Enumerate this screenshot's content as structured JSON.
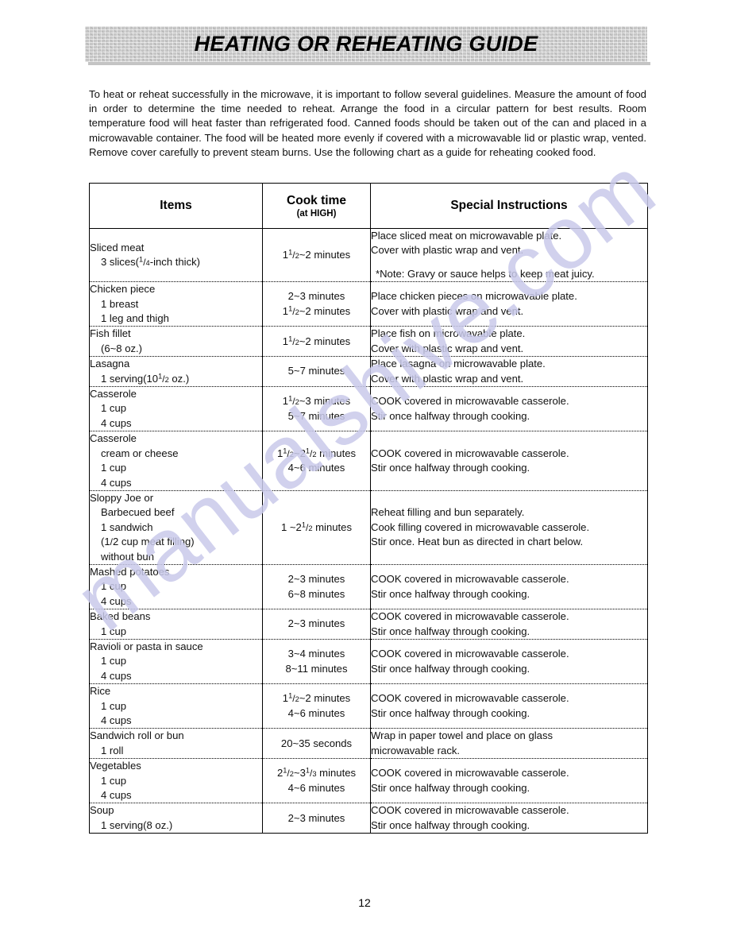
{
  "header": {
    "title": "HEATING OR REHEATING GUIDE"
  },
  "intro": {
    "paragraph": "To heat or reheat successfully in the microwave, it is important to follow several guidelines. Measure the amount of food in order to determine the time needed to reheat. Arrange the food in a circular pattern for best results. Room temperature food will heat faster than refrigerated food. Canned foods should be taken out of the can and placed in a microwavable container. The food will be heated more evenly if covered with a microwavable lid or plastic wrap, vented. Remove cover carefully to prevent steam burns. Use the following chart as a guide for reheating cooked food."
  },
  "watermark": {
    "text": "manualshive.com",
    "color": "#c9caea"
  },
  "table": {
    "columns": {
      "items": "Items",
      "cook_time": "Cook time",
      "cook_time_sub": "(at HIGH)",
      "instructions": "Special Instructions"
    },
    "rows": [
      {
        "item_title": "Sliced meat",
        "item_lines": [
          "3 slices(¹/₄-inch thick)"
        ],
        "time_lines": [
          "1¹/₂~2 minutes"
        ],
        "instr_lines": [
          "Place sliced meat on microwavable plate.",
          "Cover with plastic wrap and vent."
        ],
        "note": "*Note: Gravy or sauce helps to keep meat juicy."
      },
      {
        "item_title": "Chicken piece",
        "item_lines": [
          "1 breast",
          "1 leg and thigh"
        ],
        "time_lines": [
          "2~3 minutes",
          "1¹/₂~2 minutes"
        ],
        "instr_lines": [
          "Place chicken pieces on microwavable plate.",
          "Cover with plastic wrap and vent."
        ]
      },
      {
        "item_title": "Fish fillet",
        "item_lines": [
          "(6~8 oz.)"
        ],
        "time_lines": [
          "1¹/₂~2 minutes"
        ],
        "instr_lines": [
          "Place fish on microwavable plate.",
          "Cover with plastic wrap and vent."
        ]
      },
      {
        "item_title": "Lasagna",
        "item_lines": [
          "1 serving(10¹/₂ oz.)"
        ],
        "time_lines": [
          "5~7 minutes"
        ],
        "instr_lines": [
          "Place lasagna on microwavable plate.",
          "Cover with plastic wrap and vent."
        ]
      },
      {
        "item_title": "Casserole",
        "item_lines": [
          "1 cup",
          "4 cups"
        ],
        "time_lines": [
          "1¹/₂~3 minutes",
          "5~7 minutes"
        ],
        "instr_lines": [
          "COOK covered in microwavable casserole.",
          "Stir once halfway through cooking."
        ]
      },
      {
        "item_title": "Casserole",
        "item_lines": [
          "cream or cheese",
          "1 cup",
          "4 cups"
        ],
        "time_lines": [
          "1¹/₂~2¹/₂  minutes",
          "4~6 minutes"
        ],
        "instr_lines": [
          "COOK covered in microwavable casserole.",
          "Stir once halfway through cooking."
        ]
      },
      {
        "item_title": "Sloppy Joe or",
        "item_lines": [
          "Barbecued beef",
          "1 sandwich",
          "(1/2 cup meat filling)",
          " without bun"
        ],
        "time_lines": [
          "1 ~2¹/₂  minutes"
        ],
        "instr_lines": [
          "Reheat filling and bun separately.",
          "Cook filling covered in microwavable casserole.",
          "Stir once. Heat bun as directed in chart below."
        ]
      },
      {
        "item_title": "Mashed potatoes",
        "item_lines": [
          "1 cup",
          "4 cups"
        ],
        "time_lines": [
          "2~3  minutes",
          "6~8 minutes"
        ],
        "instr_lines": [
          "COOK covered in microwavable casserole.",
          "Stir once halfway through cooking."
        ]
      },
      {
        "item_title": "Baked beans",
        "item_lines": [
          "1 cup"
        ],
        "time_lines": [
          "2~3  minutes"
        ],
        "instr_lines": [
          "COOK covered in microwavable casserole.",
          "Stir once halfway through cooking."
        ]
      },
      {
        "item_title": "Ravioli or pasta in sauce",
        "item_lines": [
          "1 cup",
          "4 cups"
        ],
        "time_lines": [
          "3~4  minutes",
          "8~11 minutes"
        ],
        "instr_lines": [
          "COOK covered in microwavable casserole.",
          "Stir once halfway through cooking."
        ]
      },
      {
        "item_title": "Rice",
        "item_lines": [
          "1 cup",
          "4 cups"
        ],
        "time_lines": [
          "1¹/₂~2 minutes",
          "4~6 minutes"
        ],
        "instr_lines": [
          "COOK covered in microwavable casserole.",
          "Stir once halfway through cooking."
        ]
      },
      {
        "item_title": "Sandwich roll or bun",
        "item_lines": [
          "1 roll"
        ],
        "time_lines": [
          "20~35 seconds"
        ],
        "instr_lines": [
          "Wrap in paper towel and place on glass",
          "microwavable rack."
        ]
      },
      {
        "item_title": "Vegetables",
        "item_lines": [
          "1 cup",
          "4 cups"
        ],
        "time_lines": [
          "2¹/₂~3¹/₃ minutes",
          "4~6 minutes"
        ],
        "instr_lines": [
          "COOK covered in microwavable casserole.",
          "Stir once halfway through cooking."
        ]
      },
      {
        "item_title": "Soup",
        "item_lines": [
          "1 serving(8 oz.)"
        ],
        "time_lines": [
          "2~3  minutes"
        ],
        "instr_lines": [
          "COOK covered in microwavable casserole.",
          "Stir once halfway through cooking."
        ]
      }
    ]
  },
  "footer": {
    "page_number": "12"
  }
}
